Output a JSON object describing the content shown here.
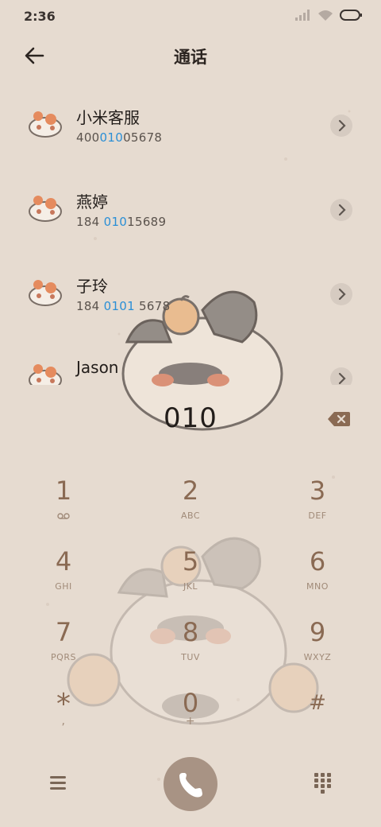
{
  "status": {
    "time": "2:36"
  },
  "header": {
    "title": "通话"
  },
  "results": [
    {
      "name": "小米客服",
      "number_parts": [
        "400",
        "010",
        "05678"
      ]
    },
    {
      "name": "燕婷",
      "number_parts": [
        "184 ",
        "010",
        "15689"
      ]
    },
    {
      "name": "子玲",
      "number_parts": [
        "184 ",
        "0101",
        " 5678"
      ]
    },
    {
      "name": "Jason",
      "number_parts": [
        "",
        "",
        ""
      ]
    }
  ],
  "dialer": {
    "entered_number": "010",
    "keys": [
      {
        "digit": "1",
        "letters": "",
        "icon": "voicemail-icon"
      },
      {
        "digit": "2",
        "letters": "ABC"
      },
      {
        "digit": "3",
        "letters": "DEF"
      },
      {
        "digit": "4",
        "letters": "GHI"
      },
      {
        "digit": "5",
        "letters": "JKL"
      },
      {
        "digit": "6",
        "letters": "MNO"
      },
      {
        "digit": "7",
        "letters": "PQRS"
      },
      {
        "digit": "8",
        "letters": "TUV"
      },
      {
        "digit": "9",
        "letters": "WXYZ"
      },
      {
        "digit": "*",
        "letters": ","
      },
      {
        "digit": "0",
        "letters": "+"
      },
      {
        "digit": "#",
        "letters": ""
      }
    ]
  },
  "colors": {
    "background": "#e6dbd0",
    "highlight": "#2b8fd6",
    "key_digit": "#8a6a53",
    "call_button": "#a89384"
  }
}
